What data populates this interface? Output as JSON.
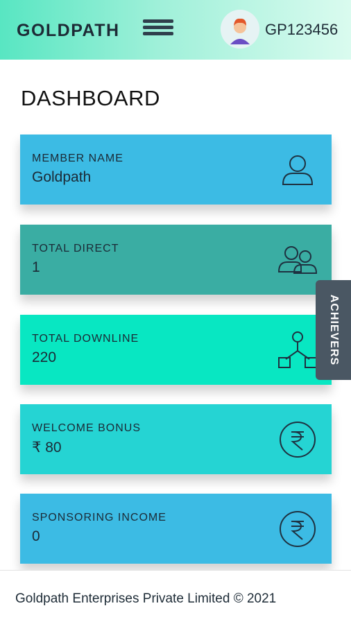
{
  "header": {
    "brand": "GOLDPATH",
    "user_id": "GP123456"
  },
  "page": {
    "title": "DASHBOARD"
  },
  "cards": [
    {
      "label": "MEMBER NAME",
      "value": "Goldpath",
      "icon": "user-icon",
      "color": "#3cbbe4"
    },
    {
      "label": "TOTAL DIRECT",
      "value": "1",
      "icon": "users-icon",
      "color": "#3aada3"
    },
    {
      "label": "TOTAL DOWNLINE",
      "value": "220",
      "icon": "network-icon",
      "color": "#08e7c2"
    },
    {
      "label": "WELCOME BONUS",
      "value": "₹ 80",
      "icon": "rupee-icon",
      "color": "#25d4d3"
    },
    {
      "label": "SPONSORING INCOME",
      "value": "0",
      "icon": "rupee-icon",
      "color": "#3cbbe4"
    }
  ],
  "side_tab": {
    "label": "ACHIEVERS"
  },
  "footer": {
    "text": "Goldpath Enterprises Private Limited © 2021"
  }
}
